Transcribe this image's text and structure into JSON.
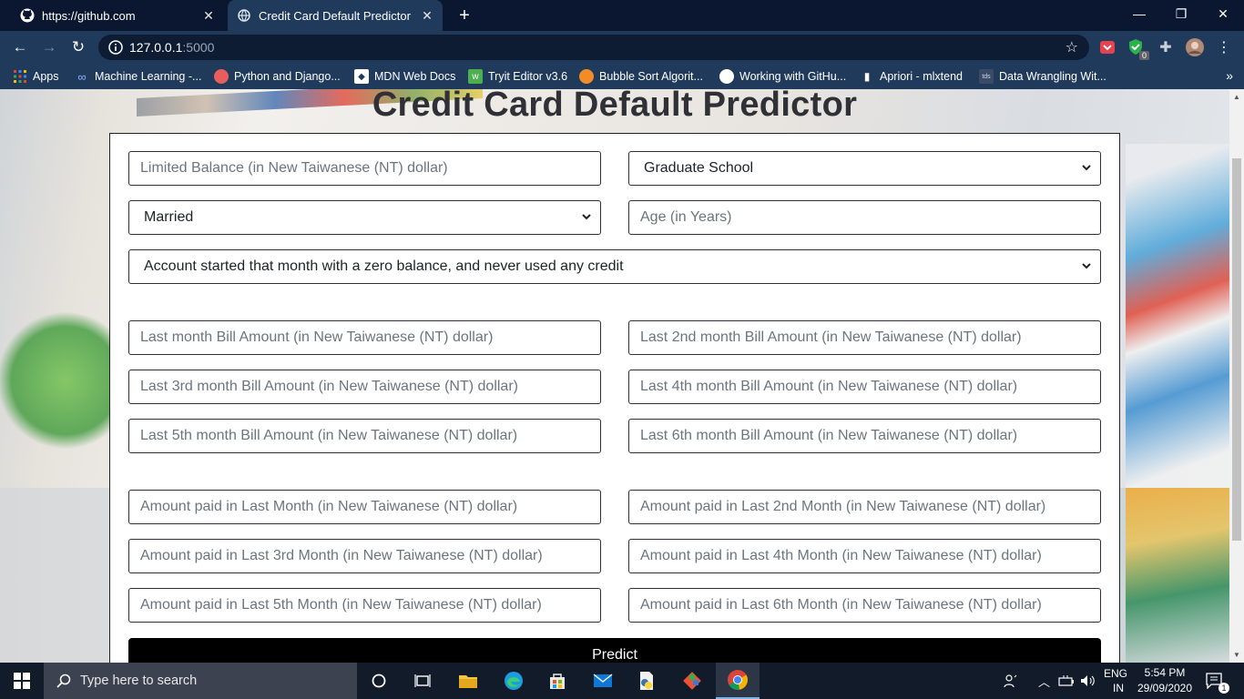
{
  "browser": {
    "tabs": [
      {
        "title": "https://github.com",
        "favicon": "github-icon",
        "active": false
      },
      {
        "title": "Credit Card Default Predictor",
        "favicon": "globe-icon",
        "active": true
      }
    ],
    "url_host": "127.0.0.1",
    "url_port": ":5000",
    "bookmarks": [
      {
        "label": "Apps",
        "icon": "apps-grid-icon"
      },
      {
        "label": "Machine Learning -...",
        "icon": "link-icon"
      },
      {
        "label": "Python and Django...",
        "icon": "site-icon"
      },
      {
        "label": "MDN Web Docs",
        "icon": "mdn-icon"
      },
      {
        "label": "Tryit Editor v3.6",
        "icon": "w3schools-icon"
      },
      {
        "label": "Bubble Sort Algorit...",
        "icon": "site-icon"
      },
      {
        "label": "Working with GitHu...",
        "icon": "github-icon"
      },
      {
        "label": "Apriori - mlxtend",
        "icon": "book-icon"
      },
      {
        "label": "Data Wrangling Wit...",
        "icon": "tds-icon"
      }
    ],
    "ext_badge": "0"
  },
  "page": {
    "title": "Credit Card Default Predictor",
    "fields": {
      "limit_balance": "Limited Balance (in New Taiwanese (NT) dollar)",
      "education": "Graduate School",
      "marriage": "Married",
      "age": "Age (in Years)",
      "repayment_status": "Account started that month with a zero balance, and never used any credit",
      "bill_1": "Last month Bill Amount (in New Taiwanese (NT) dollar)",
      "bill_2": "Last 2nd month Bill Amount (in New Taiwanese (NT) dollar)",
      "bill_3": "Last 3rd month Bill Amount (in New Taiwanese (NT) dollar)",
      "bill_4": "Last 4th month Bill Amount (in New Taiwanese (NT) dollar)",
      "bill_5": "Last 5th month Bill Amount (in New Taiwanese (NT) dollar)",
      "bill_6": "Last 6th month Bill Amount (in New Taiwanese (NT) dollar)",
      "pay_1": "Amount paid in Last Month (in New Taiwanese (NT) dollar)",
      "pay_2": "Amount paid in Last 2nd Month (in New Taiwanese (NT) dollar)",
      "pay_3": "Amount paid in Last 3rd Month (in New Taiwanese (NT) dollar)",
      "pay_4": "Amount paid in Last 4th Month (in New Taiwanese (NT) dollar)",
      "pay_5": "Amount paid in Last 5th Month (in New Taiwanese (NT) dollar)",
      "pay_6": "Amount paid in Last 6th Month (in New Taiwanese (NT) dollar)"
    },
    "predict_label": "Predict"
  },
  "taskbar": {
    "search_placeholder": "Type here to search",
    "lang_top": "ENG",
    "lang_bottom": "IN",
    "time": "5:54 PM",
    "date": "29/09/2020",
    "notification_count": "1"
  },
  "colors": {
    "tabstrip": "#0b1730",
    "toolbar": "#203a5c",
    "button": "#000000",
    "taskbar": "#121b2a"
  }
}
